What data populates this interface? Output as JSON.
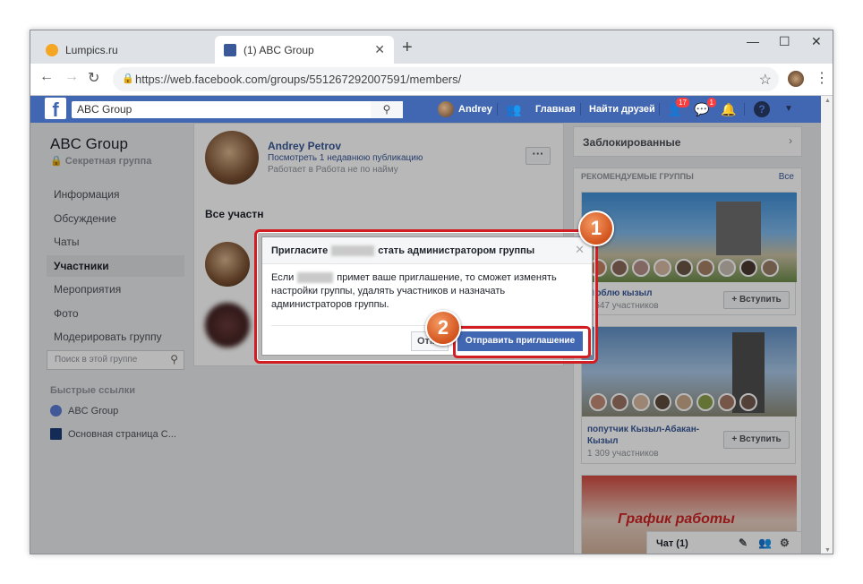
{
  "browser": {
    "tabs": [
      {
        "title": "Lumpics.ru",
        "active": false
      },
      {
        "title": "(1) ABC Group",
        "active": true
      }
    ],
    "url": "https://web.facebook.com/groups/551267292007591/members/"
  },
  "fb_header": {
    "search_value": "ABC Group",
    "user_name": "Andrey",
    "home_label": "Главная",
    "find_friends_label": "Найти друзей",
    "friend_requests_badge": "17",
    "messages_badge": "1"
  },
  "sidebar": {
    "group_name": "ABC Group",
    "group_privacy": "Секретная группа",
    "items": [
      {
        "label": "Информация",
        "active": false
      },
      {
        "label": "Обсуждение",
        "active": false
      },
      {
        "label": "Чаты",
        "active": false
      },
      {
        "label": "Участники",
        "active": true
      },
      {
        "label": "Мероприятия",
        "active": false
      },
      {
        "label": "Фото",
        "active": false
      },
      {
        "label": "Модерировать группу",
        "active": false
      }
    ],
    "search_placeholder": "Поиск в этой группе",
    "quick_links_heading": "Быстрые ссылки",
    "quick_links": [
      "ABC Group",
      "Основная страница С..."
    ]
  },
  "members": {
    "profile_name": "Andrey Petrov",
    "profile_posts": "Посмотреть 1 недавнюю публикацию",
    "profile_work": "Работает в Работа не по найму",
    "all_members_label": "Все участн"
  },
  "right": {
    "blocked_label": "Заблокированные",
    "recommended_heading": "РЕКОМЕНДУЕМЫЕ ГРУППЫ",
    "all_label": "Все",
    "groups": [
      {
        "name": "Люблю кызыл",
        "members": "1 547 участников",
        "join": "+ Вступить"
      },
      {
        "name": "попутчик Кызыл-Абакан-Кызыл",
        "members": "1 309 участников",
        "join": "+ Вступить"
      },
      {
        "image_text": "График работы"
      }
    ]
  },
  "chat": {
    "label": "Чат (1)"
  },
  "dialog": {
    "title_before": "Пригласите",
    "title_after": "стать администратором группы",
    "body_before": "Если",
    "body_after": "примет ваше приглашение, то сможет изменять настройки группы, удалять участников и назначать администраторов группы.",
    "cancel_label": "Отмена",
    "send_label": "Отправить приглашение"
  },
  "annotations": {
    "step1": "1",
    "step2": "2"
  },
  "colors": {
    "fb_blue": "#4267b2",
    "annotation_red": "#d21d23",
    "annotation_orange": "#e06a2c"
  }
}
